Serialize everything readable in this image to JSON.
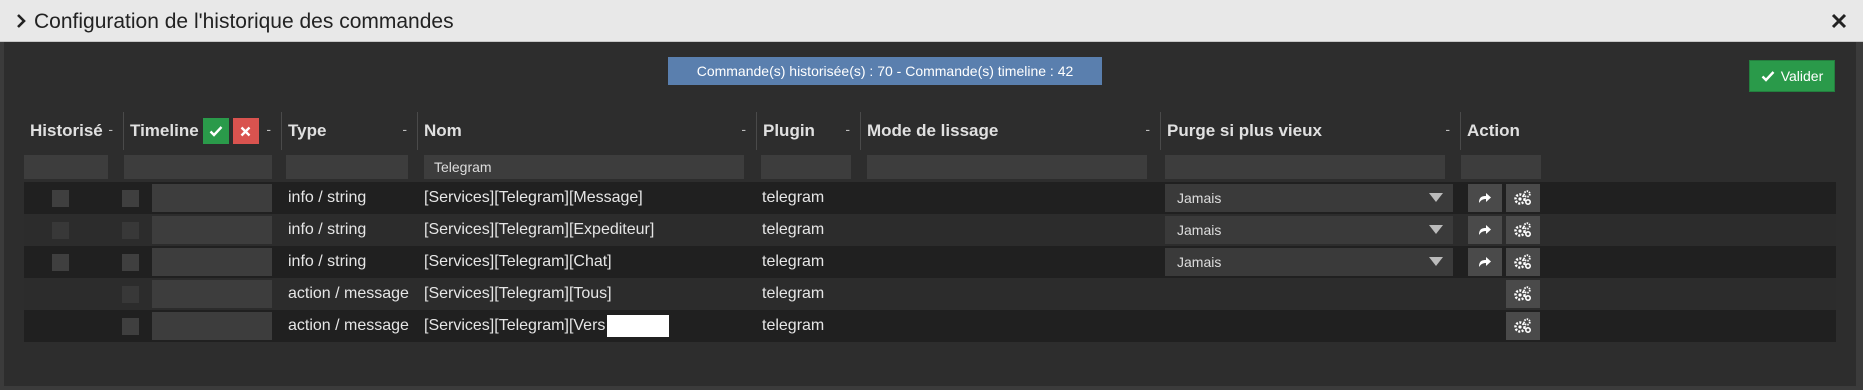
{
  "window": {
    "title": "Configuration de l'historique des commandes",
    "close_icon": "close-icon",
    "expand_icon": "chevron-right-icon"
  },
  "summary": {
    "count_text": "Commande(s) historisée(s) : 70 - Commande(s) timeline : 42"
  },
  "toolbar": {
    "valider_label": "Valider"
  },
  "table": {
    "headers": {
      "historise": "Historisé",
      "timeline": "Timeline",
      "type": "Type",
      "nom": "Nom",
      "plugin": "Plugin",
      "lissage": "Mode de lissage",
      "purge": "Purge si plus vieux",
      "action": "Action",
      "sort_marker": "-"
    },
    "filters": {
      "nom": "Telegram"
    },
    "rows": [
      {
        "type": "info / string",
        "nom": "[Services][Telegram][Message]",
        "plugin": "telegram",
        "purge": "Jamais"
      },
      {
        "type": "info / string",
        "nom": "[Services][Telegram][Expediteur]",
        "plugin": "telegram",
        "purge": "Jamais"
      },
      {
        "type": "info / string",
        "nom": "[Services][Telegram][Chat]",
        "plugin": "telegram",
        "purge": "Jamais"
      },
      {
        "type": "action / message",
        "nom": "[Services][Telegram][Tous]",
        "plugin": "telegram",
        "purge": ""
      },
      {
        "type": "action / message",
        "nom": "[Services][Telegram][Vers",
        "plugin": "telegram",
        "purge": ""
      }
    ]
  },
  "colors": {
    "badge": "#5a7fae",
    "valider": "#2a9a4a",
    "timeline_reject": "#d9534f"
  }
}
